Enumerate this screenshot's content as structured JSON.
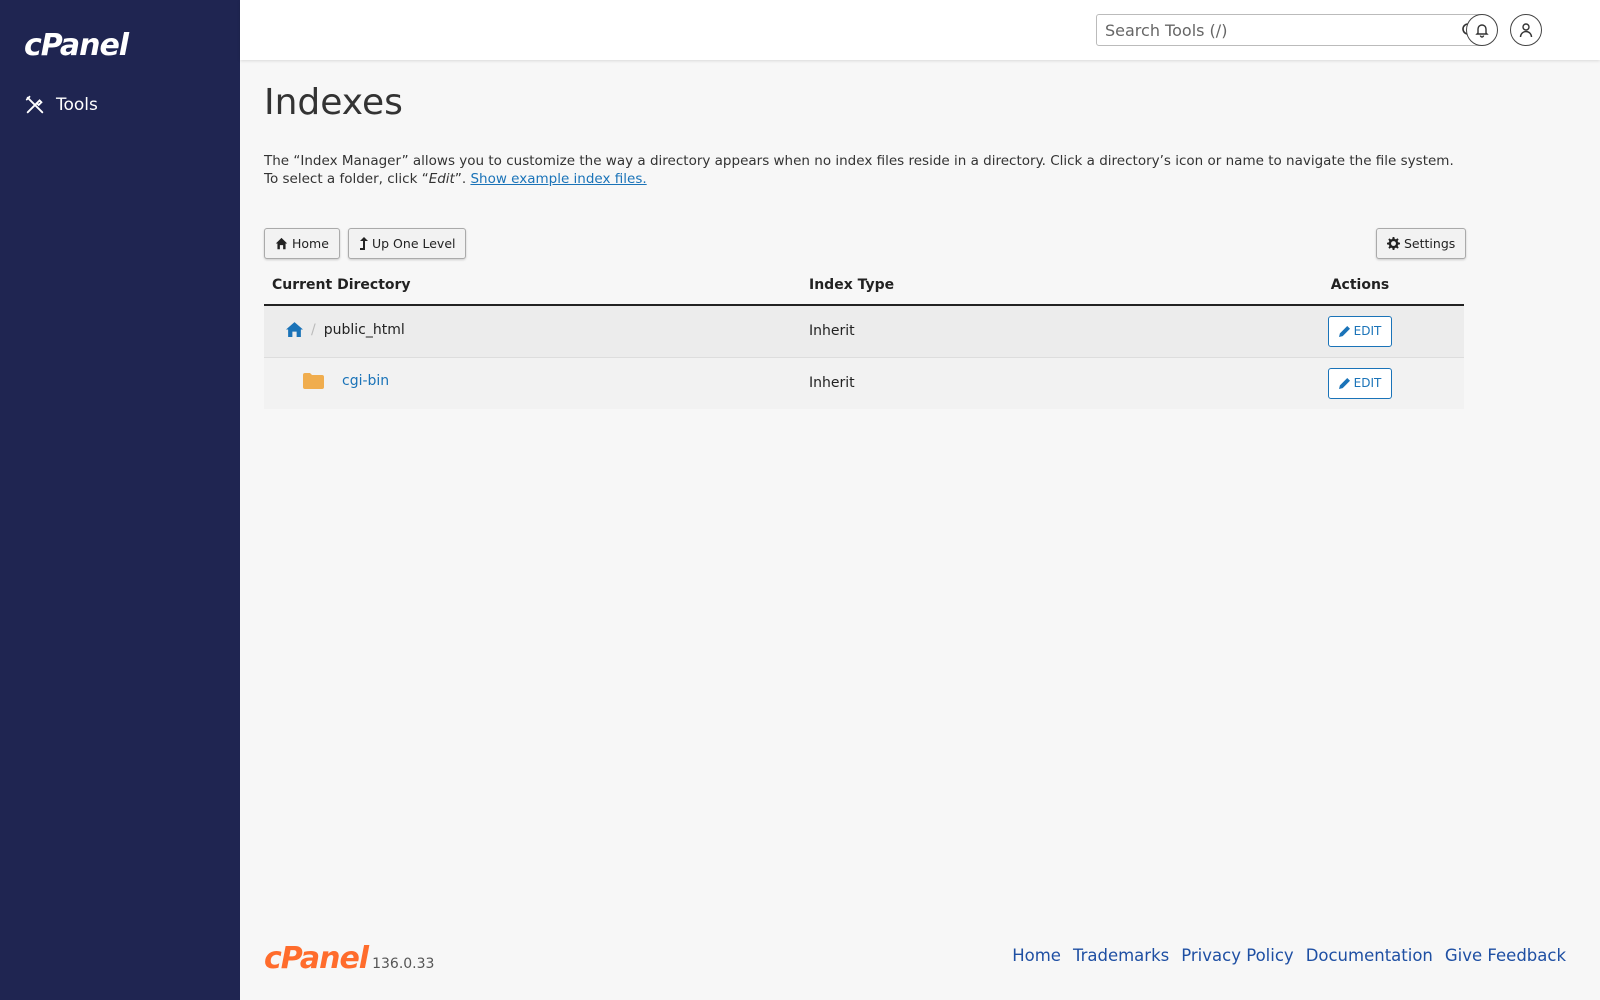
{
  "sidebar": {
    "logo": "cPanel",
    "items": [
      {
        "label": "Tools",
        "icon": "tools-icon"
      }
    ]
  },
  "topbar": {
    "search_placeholder": "Search Tools (/)"
  },
  "main": {
    "title": "Indexes",
    "description_pre": "The “Index Manager” allows you to customize the way a directory appears when no index files reside in a directory. Click a directory’s icon or name to navigate the file system. To select a folder, click “",
    "description_em": "Edit",
    "description_post": "”. ",
    "description_link": "Show example index files.",
    "buttons": {
      "home": "Home",
      "up": "Up One Level",
      "settings": "Settings"
    },
    "table": {
      "headers": [
        "Current Directory",
        "Index Type",
        "Actions"
      ],
      "rows": [
        {
          "separator": "/",
          "name": "public_html",
          "type": "Inherit",
          "action": "EDIT"
        },
        {
          "name": "cgi-bin",
          "type": "Inherit",
          "action": "EDIT"
        }
      ]
    }
  },
  "footer": {
    "brand": "cPanel",
    "version": "136.0.33",
    "links": [
      "Home",
      "Trademarks",
      "Privacy Policy",
      "Documentation",
      "Give Feedback"
    ]
  },
  "colors": {
    "sidebar_bg": "#1f2551",
    "link": "#1a73b8",
    "brand_orange": "#ff6c2c",
    "folder": "#f0ad4e"
  }
}
